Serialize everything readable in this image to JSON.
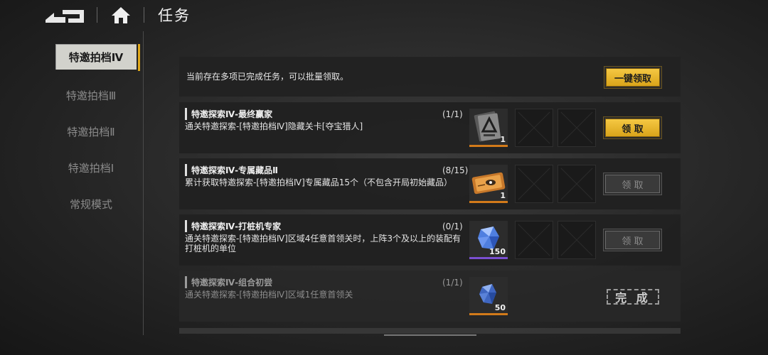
{
  "header": {
    "title": "任务"
  },
  "sidebar": {
    "items": [
      {
        "label": "特邀拍档Ⅳ",
        "active": true
      },
      {
        "label": "特邀拍档Ⅲ",
        "active": false
      },
      {
        "label": "特邀拍档Ⅱ",
        "active": false
      },
      {
        "label": "特邀拍档Ⅰ",
        "active": false
      },
      {
        "label": "常规模式",
        "active": false
      }
    ]
  },
  "notice": {
    "text": "当前存在多项已完成任务，可以批量领取。",
    "button_label": "一键领取"
  },
  "tasks": [
    {
      "title": "特邀探索Ⅳ-最终赢家",
      "progress": "(1/1)",
      "desc": "通关特邀探索-[特邀拍档Ⅳ]隐藏关卡[夺宝猎人]",
      "reward_icon": "card-item-icon",
      "reward_count": "1",
      "button_label": "领 取",
      "button_state": "active"
    },
    {
      "title": "特邀探索Ⅳ-专属藏品Ⅱ",
      "progress": "(8/15)",
      "desc": "累计获取特邀探索-[特邀拍档Ⅳ]专属藏品15个（不包含开局初始藏品）",
      "reward_icon": "ticket-item-icon",
      "reward_count": "1",
      "button_label": "领 取",
      "button_state": "disabled"
    },
    {
      "title": "特邀探索Ⅳ-打桩机专家",
      "progress": "(0/1)",
      "desc": "通关特邀探索-[特邀拍档Ⅳ]区域4任意首领关时，上阵3个及以上的装配有打桩机的单位",
      "reward_icon": "crystal-item-icon",
      "reward_count": "150",
      "button_label": "领 取",
      "button_state": "disabled"
    },
    {
      "title": "特邀探索Ⅳ-组合初尝",
      "progress": "(1/1)",
      "desc": "通关特邀探索-[特邀拍档Ⅳ]区域1任意首领关",
      "reward_icon": "crystal-item-icon",
      "reward_count": "50",
      "button_label": "完 成",
      "button_state": "done"
    }
  ],
  "colors": {
    "accent": "#f0bd32",
    "reward_orange": "#d27a1a",
    "reward_purple": "#7a4fd0"
  }
}
